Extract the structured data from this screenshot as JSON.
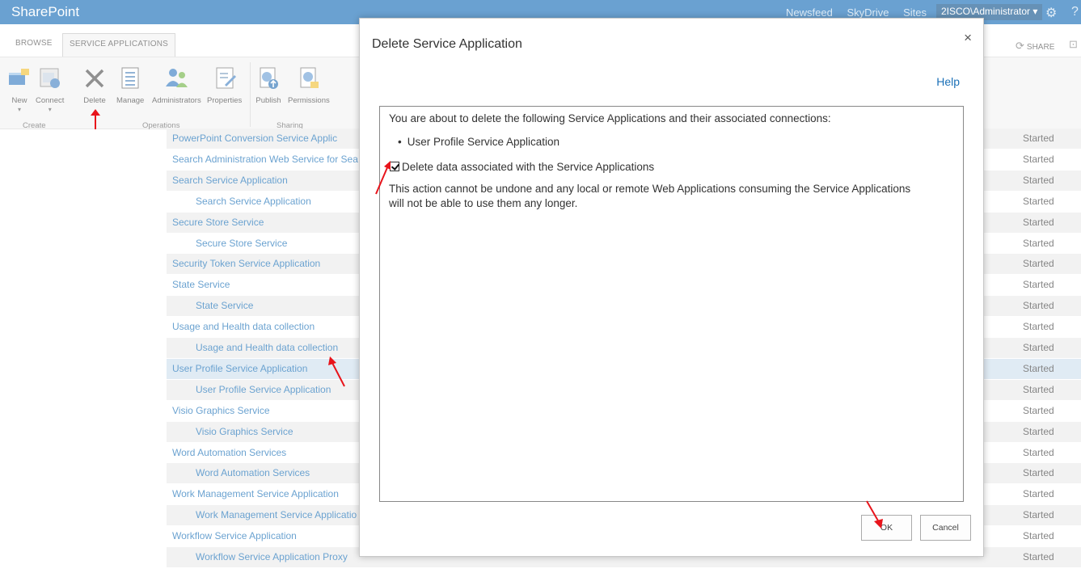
{
  "suite": {
    "title": "SharePoint",
    "links": [
      "Newsfeed",
      "SkyDrive",
      "Sites"
    ],
    "user": "2ISCO\\Administrator ▾"
  },
  "tabs": {
    "browse": "BROWSE",
    "service_applications": "SERVICE APPLICATIONS",
    "share": "SHARE"
  },
  "ribbon": {
    "buttons": {
      "new": "New",
      "connect": "Connect",
      "delete": "Delete",
      "manage": "Manage",
      "administrators": "Administrators",
      "properties": "Properties",
      "publish": "Publish",
      "permissions": "Permissions"
    },
    "groups": {
      "create": "Create",
      "operations": "Operations",
      "sharing": "Sharing"
    }
  },
  "list": {
    "rows": [
      {
        "name": "PowerPoint Conversion Service Applic",
        "level": 0,
        "status": "Started"
      },
      {
        "name": "Search Administration Web Service for Sea",
        "level": 0,
        "status": "Started"
      },
      {
        "name": "Search Service Application",
        "level": 0,
        "status": "Started"
      },
      {
        "name": "Search Service Application",
        "level": 1,
        "status": "Started"
      },
      {
        "name": "Secure Store Service",
        "level": 0,
        "status": "Started"
      },
      {
        "name": "Secure Store Service",
        "level": 1,
        "status": "Started"
      },
      {
        "name": "Security Token Service Application",
        "level": 0,
        "status": "Started"
      },
      {
        "name": "State Service",
        "level": 0,
        "status": "Started"
      },
      {
        "name": "State Service",
        "level": 1,
        "status": "Started"
      },
      {
        "name": "Usage and Health data collection",
        "level": 0,
        "status": "Started"
      },
      {
        "name": "Usage and Health data collection",
        "level": 1,
        "status": "Started"
      },
      {
        "name": "User Profile Service Application",
        "level": 0,
        "status": "Started",
        "selected": true
      },
      {
        "name": "User Profile Service Application",
        "level": 1,
        "status": "Started"
      },
      {
        "name": "Visio Graphics Service",
        "level": 0,
        "status": "Started"
      },
      {
        "name": "Visio Graphics Service",
        "level": 1,
        "status": "Started"
      },
      {
        "name": "Word Automation Services",
        "level": 0,
        "status": "Started"
      },
      {
        "name": "Word Automation Services",
        "level": 1,
        "status": "Started"
      },
      {
        "name": "Work Management Service Application",
        "level": 0,
        "status": "Started"
      },
      {
        "name": "Work Management Service Applicatio",
        "level": 1,
        "status": "Started"
      },
      {
        "name": "Workflow Service Application",
        "level": 0,
        "status": "Started"
      },
      {
        "name": "Workflow Service Application Proxy",
        "level": 1,
        "status": "Started"
      }
    ]
  },
  "dialog": {
    "title": "Delete Service Application",
    "close": "×",
    "help": "Help",
    "message": "You are about to delete the following Service Applications and their associated connections:",
    "bullet": "User Profile Service Application",
    "checkbox_label": "Delete data associated with the Service Applications",
    "checkbox_checked": true,
    "warning": "This action cannot be undone and any local or remote Web Applications consuming the Service Applications will not be able to use them any longer.",
    "ok": "OK",
    "cancel": "Cancel"
  },
  "colors": {
    "suitebar": "#1b6fb8",
    "link": "#1b70b7",
    "annotation": "#e8141b"
  }
}
